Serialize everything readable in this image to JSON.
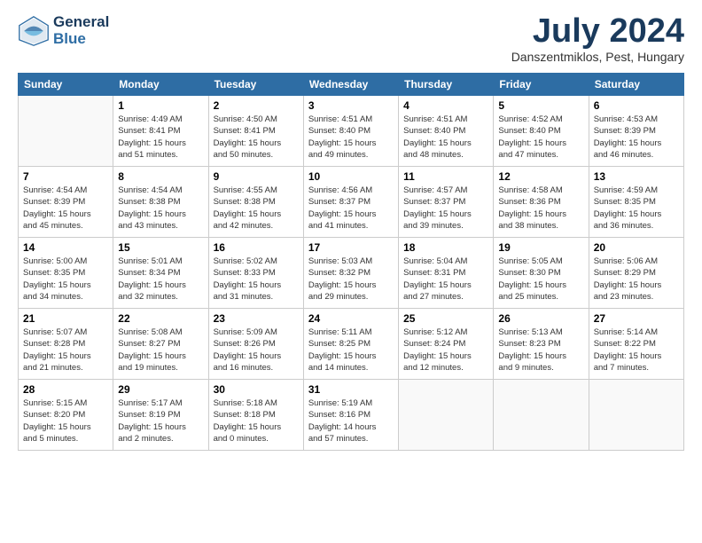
{
  "header": {
    "logo_line1": "General",
    "logo_line2": "Blue",
    "month": "July 2024",
    "location": "Danszentmiklos, Pest, Hungary"
  },
  "days_of_week": [
    "Sunday",
    "Monday",
    "Tuesday",
    "Wednesday",
    "Thursday",
    "Friday",
    "Saturday"
  ],
  "weeks": [
    [
      {
        "day": "",
        "sunrise": "",
        "sunset": "",
        "daylight": ""
      },
      {
        "day": "1",
        "sunrise": "Sunrise: 4:49 AM",
        "sunset": "Sunset: 8:41 PM",
        "daylight": "Daylight: 15 hours and 51 minutes."
      },
      {
        "day": "2",
        "sunrise": "Sunrise: 4:50 AM",
        "sunset": "Sunset: 8:41 PM",
        "daylight": "Daylight: 15 hours and 50 minutes."
      },
      {
        "day": "3",
        "sunrise": "Sunrise: 4:51 AM",
        "sunset": "Sunset: 8:40 PM",
        "daylight": "Daylight: 15 hours and 49 minutes."
      },
      {
        "day": "4",
        "sunrise": "Sunrise: 4:51 AM",
        "sunset": "Sunset: 8:40 PM",
        "daylight": "Daylight: 15 hours and 48 minutes."
      },
      {
        "day": "5",
        "sunrise": "Sunrise: 4:52 AM",
        "sunset": "Sunset: 8:40 PM",
        "daylight": "Daylight: 15 hours and 47 minutes."
      },
      {
        "day": "6",
        "sunrise": "Sunrise: 4:53 AM",
        "sunset": "Sunset: 8:39 PM",
        "daylight": "Daylight: 15 hours and 46 minutes."
      }
    ],
    [
      {
        "day": "7",
        "sunrise": "Sunrise: 4:54 AM",
        "sunset": "Sunset: 8:39 PM",
        "daylight": "Daylight: 15 hours and 45 minutes."
      },
      {
        "day": "8",
        "sunrise": "Sunrise: 4:54 AM",
        "sunset": "Sunset: 8:38 PM",
        "daylight": "Daylight: 15 hours and 43 minutes."
      },
      {
        "day": "9",
        "sunrise": "Sunrise: 4:55 AM",
        "sunset": "Sunset: 8:38 PM",
        "daylight": "Daylight: 15 hours and 42 minutes."
      },
      {
        "day": "10",
        "sunrise": "Sunrise: 4:56 AM",
        "sunset": "Sunset: 8:37 PM",
        "daylight": "Daylight: 15 hours and 41 minutes."
      },
      {
        "day": "11",
        "sunrise": "Sunrise: 4:57 AM",
        "sunset": "Sunset: 8:37 PM",
        "daylight": "Daylight: 15 hours and 39 minutes."
      },
      {
        "day": "12",
        "sunrise": "Sunrise: 4:58 AM",
        "sunset": "Sunset: 8:36 PM",
        "daylight": "Daylight: 15 hours and 38 minutes."
      },
      {
        "day": "13",
        "sunrise": "Sunrise: 4:59 AM",
        "sunset": "Sunset: 8:35 PM",
        "daylight": "Daylight: 15 hours and 36 minutes."
      }
    ],
    [
      {
        "day": "14",
        "sunrise": "Sunrise: 5:00 AM",
        "sunset": "Sunset: 8:35 PM",
        "daylight": "Daylight: 15 hours and 34 minutes."
      },
      {
        "day": "15",
        "sunrise": "Sunrise: 5:01 AM",
        "sunset": "Sunset: 8:34 PM",
        "daylight": "Daylight: 15 hours and 32 minutes."
      },
      {
        "day": "16",
        "sunrise": "Sunrise: 5:02 AM",
        "sunset": "Sunset: 8:33 PM",
        "daylight": "Daylight: 15 hours and 31 minutes."
      },
      {
        "day": "17",
        "sunrise": "Sunrise: 5:03 AM",
        "sunset": "Sunset: 8:32 PM",
        "daylight": "Daylight: 15 hours and 29 minutes."
      },
      {
        "day": "18",
        "sunrise": "Sunrise: 5:04 AM",
        "sunset": "Sunset: 8:31 PM",
        "daylight": "Daylight: 15 hours and 27 minutes."
      },
      {
        "day": "19",
        "sunrise": "Sunrise: 5:05 AM",
        "sunset": "Sunset: 8:30 PM",
        "daylight": "Daylight: 15 hours and 25 minutes."
      },
      {
        "day": "20",
        "sunrise": "Sunrise: 5:06 AM",
        "sunset": "Sunset: 8:29 PM",
        "daylight": "Daylight: 15 hours and 23 minutes."
      }
    ],
    [
      {
        "day": "21",
        "sunrise": "Sunrise: 5:07 AM",
        "sunset": "Sunset: 8:28 PM",
        "daylight": "Daylight: 15 hours and 21 minutes."
      },
      {
        "day": "22",
        "sunrise": "Sunrise: 5:08 AM",
        "sunset": "Sunset: 8:27 PM",
        "daylight": "Daylight: 15 hours and 19 minutes."
      },
      {
        "day": "23",
        "sunrise": "Sunrise: 5:09 AM",
        "sunset": "Sunset: 8:26 PM",
        "daylight": "Daylight: 15 hours and 16 minutes."
      },
      {
        "day": "24",
        "sunrise": "Sunrise: 5:11 AM",
        "sunset": "Sunset: 8:25 PM",
        "daylight": "Daylight: 15 hours and 14 minutes."
      },
      {
        "day": "25",
        "sunrise": "Sunrise: 5:12 AM",
        "sunset": "Sunset: 8:24 PM",
        "daylight": "Daylight: 15 hours and 12 minutes."
      },
      {
        "day": "26",
        "sunrise": "Sunrise: 5:13 AM",
        "sunset": "Sunset: 8:23 PM",
        "daylight": "Daylight: 15 hours and 9 minutes."
      },
      {
        "day": "27",
        "sunrise": "Sunrise: 5:14 AM",
        "sunset": "Sunset: 8:22 PM",
        "daylight": "Daylight: 15 hours and 7 minutes."
      }
    ],
    [
      {
        "day": "28",
        "sunrise": "Sunrise: 5:15 AM",
        "sunset": "Sunset: 8:20 PM",
        "daylight": "Daylight: 15 hours and 5 minutes."
      },
      {
        "day": "29",
        "sunrise": "Sunrise: 5:17 AM",
        "sunset": "Sunset: 8:19 PM",
        "daylight": "Daylight: 15 hours and 2 minutes."
      },
      {
        "day": "30",
        "sunrise": "Sunrise: 5:18 AM",
        "sunset": "Sunset: 8:18 PM",
        "daylight": "Daylight: 15 hours and 0 minutes."
      },
      {
        "day": "31",
        "sunrise": "Sunrise: 5:19 AM",
        "sunset": "Sunset: 8:16 PM",
        "daylight": "Daylight: 14 hours and 57 minutes."
      },
      {
        "day": "",
        "sunrise": "",
        "sunset": "",
        "daylight": ""
      },
      {
        "day": "",
        "sunrise": "",
        "sunset": "",
        "daylight": ""
      },
      {
        "day": "",
        "sunrise": "",
        "sunset": "",
        "daylight": ""
      }
    ]
  ]
}
